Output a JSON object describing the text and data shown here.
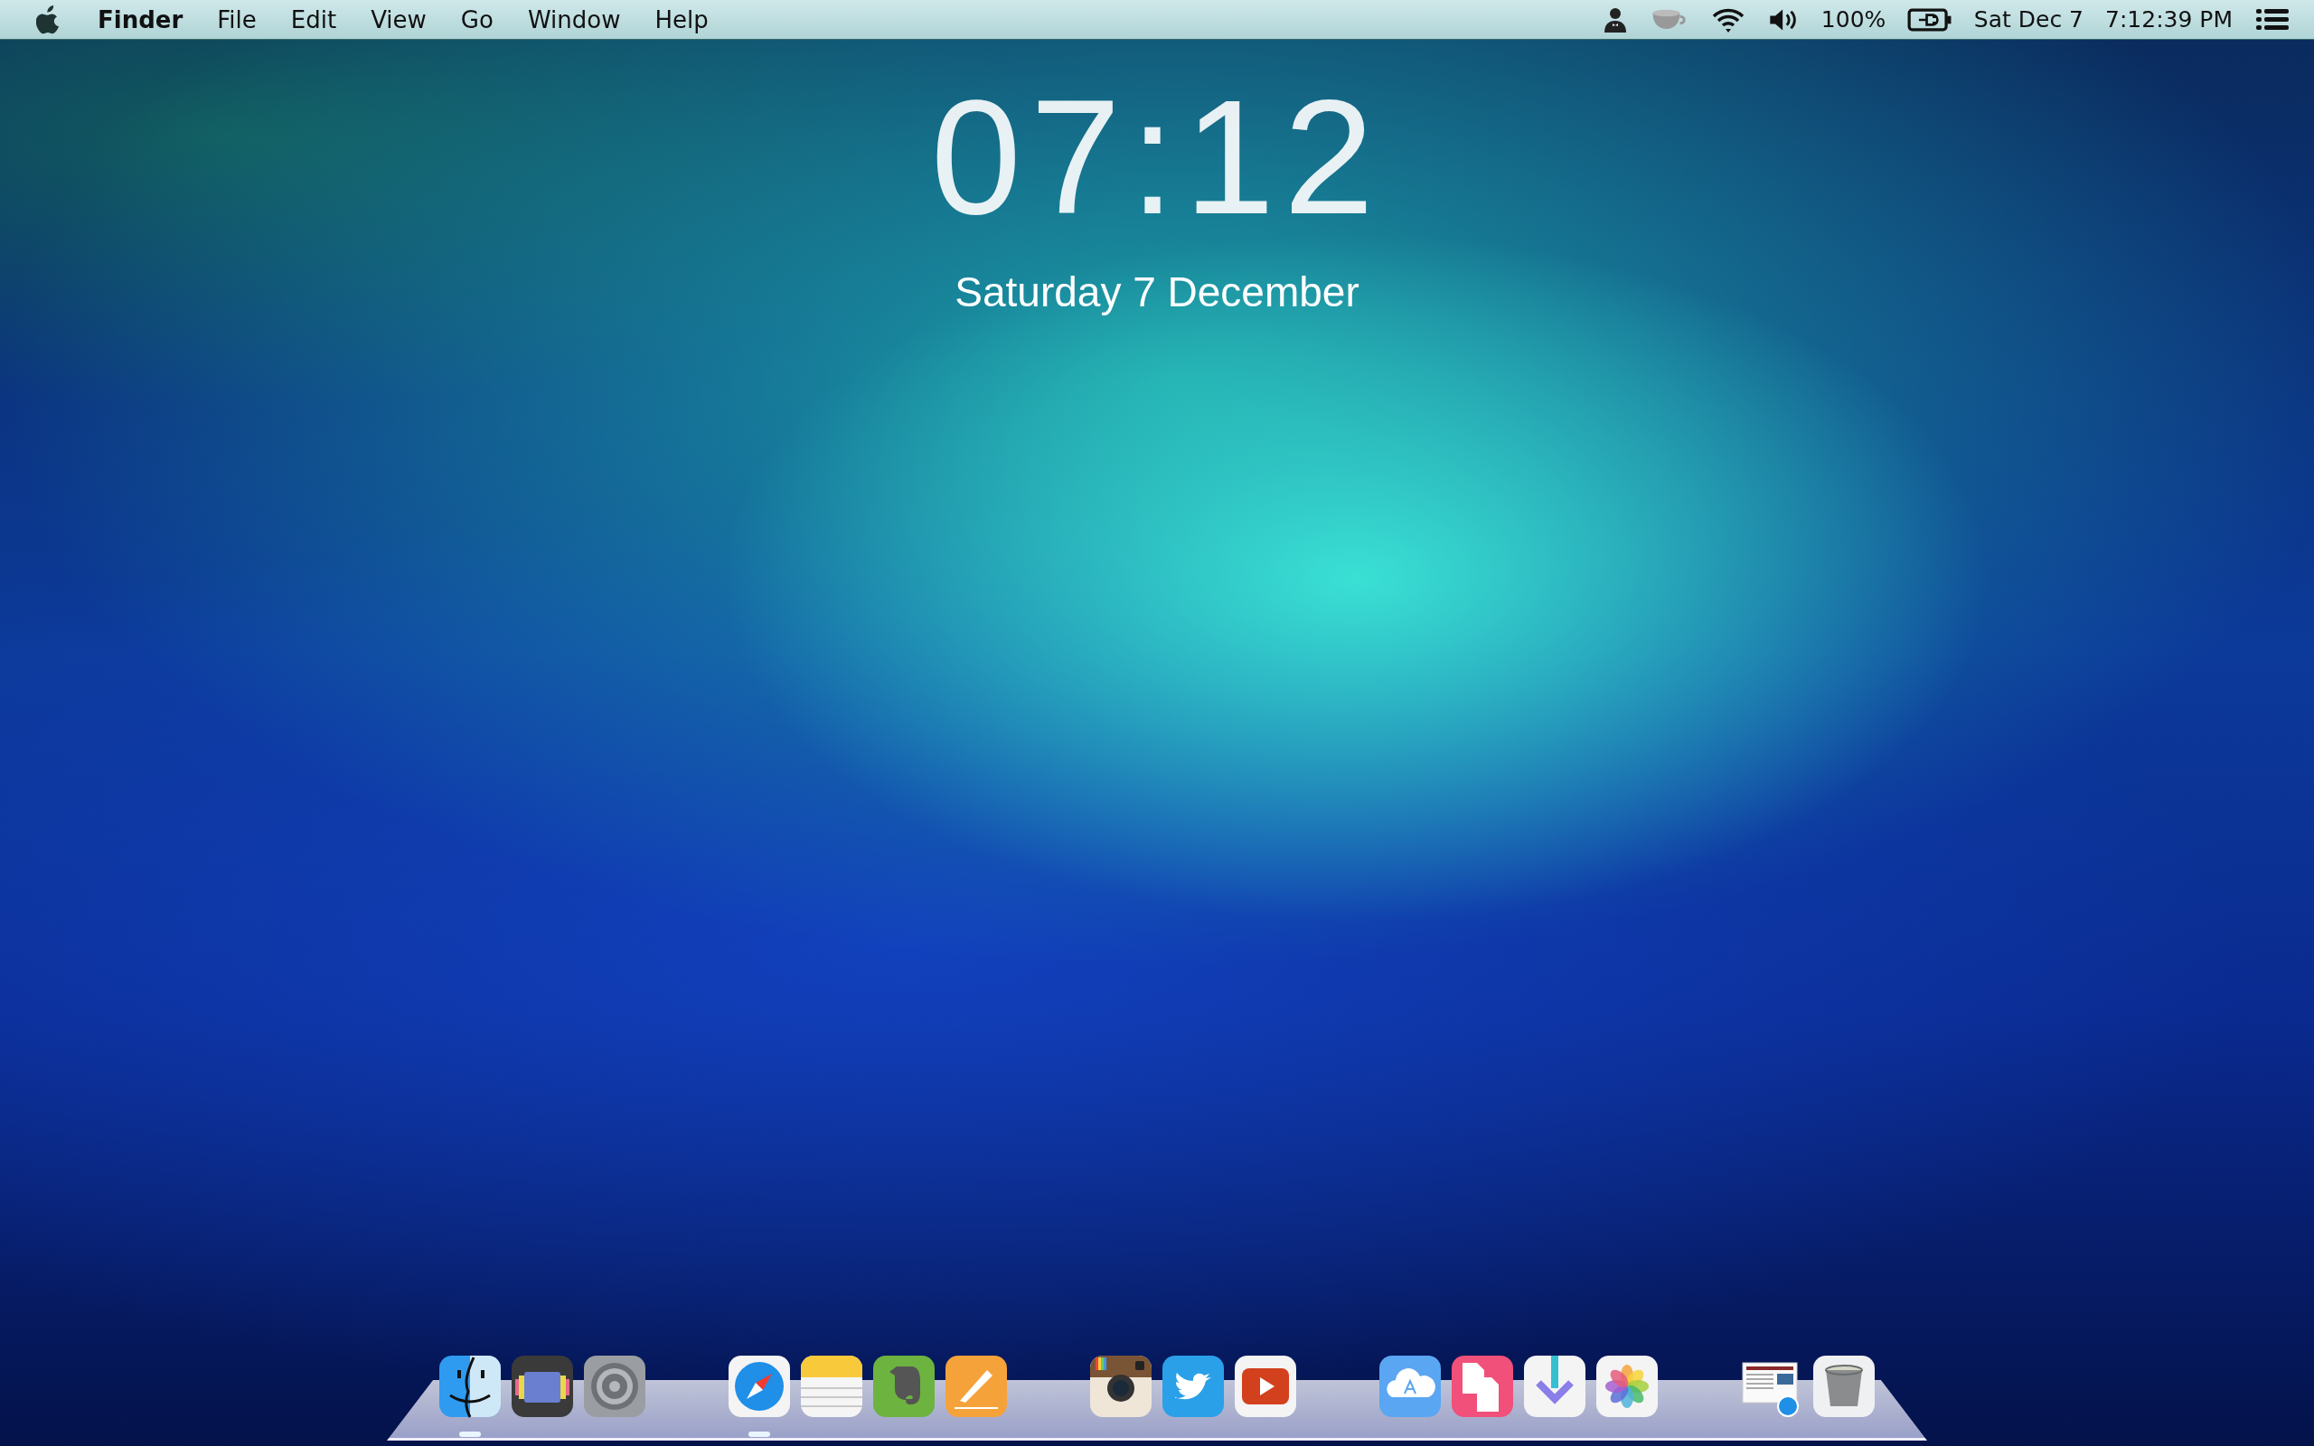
{
  "menu_bar": {
    "app_name": "Finder",
    "menus": [
      "File",
      "Edit",
      "View",
      "Go",
      "Window",
      "Help"
    ],
    "battery_percent": "100%",
    "date": "Sat Dec 7",
    "time": "7:12:39 PM"
  },
  "lock_clock": {
    "time": "07:12",
    "date": "Saturday  7 December"
  },
  "dock": {
    "groups": [
      {
        "items": [
          {
            "kind": "finder",
            "running": true
          },
          {
            "kind": "colors",
            "running": false
          },
          {
            "kind": "settings",
            "running": false
          }
        ]
      },
      {
        "items": [
          {
            "kind": "safari",
            "running": true
          },
          {
            "kind": "notes",
            "running": false
          },
          {
            "kind": "evernote",
            "running": false
          },
          {
            "kind": "pages",
            "running": false
          }
        ]
      },
      {
        "items": [
          {
            "kind": "camera",
            "running": false
          },
          {
            "kind": "twitter",
            "running": false
          },
          {
            "kind": "video",
            "running": false
          }
        ]
      },
      {
        "items": [
          {
            "kind": "appstore",
            "running": false
          },
          {
            "kind": "documents",
            "running": false
          },
          {
            "kind": "download",
            "running": false
          },
          {
            "kind": "photos",
            "running": false
          }
        ]
      },
      {
        "items": [
          {
            "kind": "webpage",
            "running": false
          },
          {
            "kind": "trash",
            "running": false
          }
        ]
      }
    ]
  }
}
